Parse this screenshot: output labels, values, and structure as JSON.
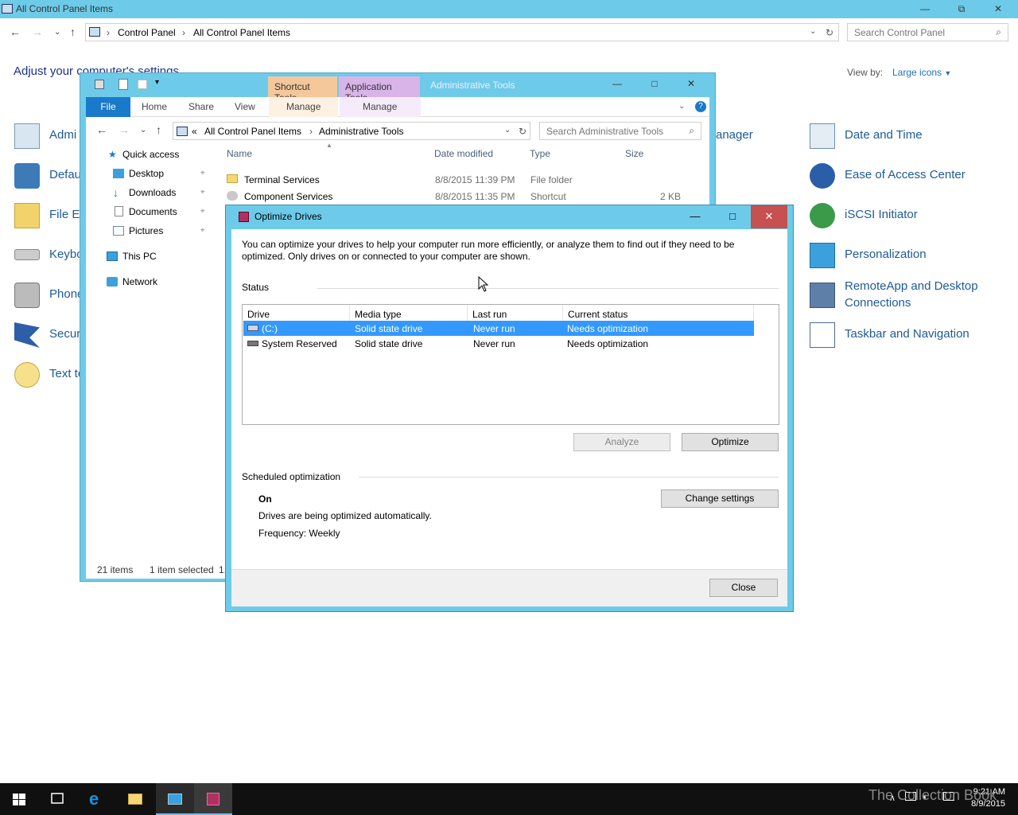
{
  "control_panel": {
    "title": "All Control Panel Items",
    "breadcrumb": [
      "Control Panel",
      "All Control Panel Items"
    ],
    "search_placeholder": "Search Control Panel",
    "heading": "Adjust your computer's settings",
    "view_by_label": "View by:",
    "view_by_value": "Large icons",
    "left_items": [
      "Admi",
      "Defau",
      "File Ex",
      "Keybo",
      "Phone",
      "Secur",
      "Text to"
    ],
    "mid_item": "anager",
    "right_items": [
      "Date and Time",
      "Ease of Access Center",
      "iSCSI Initiator",
      "Personalization",
      "RemoteApp and Desktop",
      "Connections",
      "Taskbar and Navigation"
    ]
  },
  "explorer": {
    "title": "Administrative Tools",
    "context_tabs": [
      "Shortcut Tools",
      "Application Tools"
    ],
    "ribbon_tabs": [
      "File",
      "Home",
      "Share",
      "View",
      "Manage",
      "Manage"
    ],
    "breadcrumb_prefix": "«",
    "breadcrumb": [
      "All Control Panel Items",
      "Administrative Tools"
    ],
    "search_placeholder": "Search Administrative Tools",
    "nav": {
      "quick_access": "Quick access",
      "desktop": "Desktop",
      "downloads": "Downloads",
      "documents": "Documents",
      "pictures": "Pictures",
      "this_pc": "This PC",
      "network": "Network"
    },
    "columns": [
      "Name",
      "Date modified",
      "Type",
      "Size"
    ],
    "files": [
      {
        "name": "Terminal Services",
        "date": "8/8/2015 11:39 PM",
        "type": "File folder",
        "size": ""
      },
      {
        "name": "Component Services",
        "date": "8/8/2015 11:35 PM",
        "type": "Shortcut",
        "size": "2 KB"
      }
    ],
    "status_items": "21 items",
    "status_selected": "1 item selected",
    "status_size": "1."
  },
  "dialog": {
    "title": "Optimize Drives",
    "intro": "You can optimize your drives to help your computer run more efficiently, or analyze them to find out if they need to be optimized. Only drives on or connected to your computer are shown.",
    "status_label": "Status",
    "columns": [
      "Drive",
      "Media type",
      "Last run",
      "Current status"
    ],
    "drives": [
      {
        "drive": "(C:)",
        "media": "Solid state drive",
        "last_run": "Never run",
        "status": "Needs optimization"
      },
      {
        "drive": "System Reserved",
        "media": "Solid state drive",
        "last_run": "Never run",
        "status": "Needs optimization"
      }
    ],
    "analyze_label": "Analyze",
    "optimize_label": "Optimize",
    "scheduled_label": "Scheduled optimization",
    "sched_state": "On",
    "sched_desc": "Drives are being optimized automatically.",
    "sched_freq": "Frequency: Weekly",
    "change_settings_label": "Change settings",
    "close_label": "Close"
  },
  "taskbar": {
    "time": "9:21 AM",
    "date": "8/9/2015",
    "watermark": "The Collection Book"
  },
  "colors": {
    "title_bar": "#6dcbe9",
    "link": "#1e5a96",
    "selection": "#3399ff",
    "close_red": "#c75050",
    "taskbar": "#101010"
  }
}
